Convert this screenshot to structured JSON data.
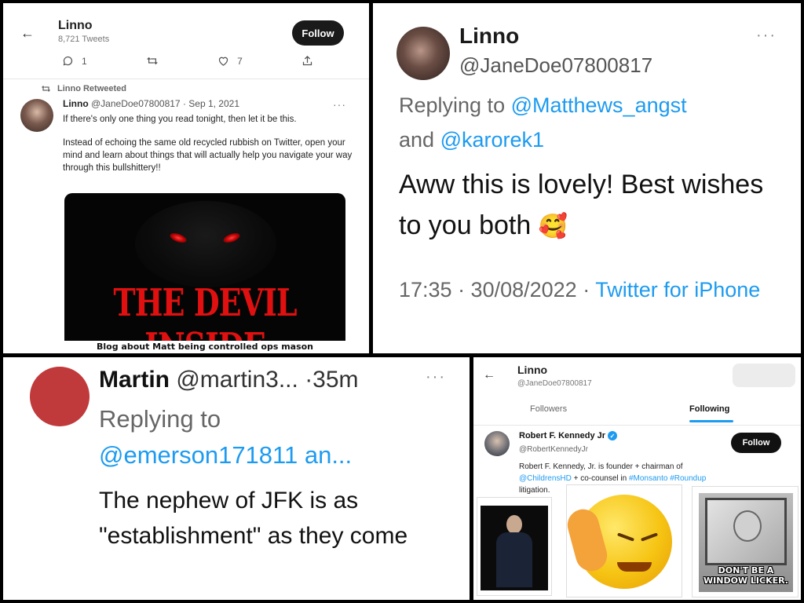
{
  "panel1": {
    "profile_name": "Linno",
    "tweet_count": "8,721 Tweets",
    "follow_label": "Follow",
    "actions": {
      "replies": "1",
      "likes": "7"
    },
    "retweeted_label": "Linno Retweeted",
    "tweet": {
      "author": "Linno",
      "handle": "@JaneDoe07800817",
      "date": "· Sep 1, 2021",
      "line1": "If there's only one thing you read tonight, then let it be this.",
      "line2": "Instead of echoing the same old recycled rubbish on Twitter, open your mind and learn about things that will actually help you navigate your way through this bullshittery!!"
    },
    "image_title": "THE DEVIL INSIDE",
    "caption": "Blog about Matt being controlled ops mason"
  },
  "panel2": {
    "name": "Linno",
    "handle": "@JaneDoe07800817",
    "replying_prefix": "Replying to",
    "mention1": "@Matthews_angst",
    "and": "and",
    "mention2": "@karorek1",
    "body": "Aww this is lovely! Best wishes to you both",
    "emoji": "🥰",
    "timestamp": "17:35 · 30/08/2022 ·",
    "source": "Twitter for iPhone"
  },
  "panel3": {
    "name": "Martin",
    "handle": "@martin3...",
    "time": "·35m",
    "replying_prefix": "Replying to",
    "mention": "@emerson171811 an...",
    "body": "The nephew of JFK is as \"establishment\" as they come"
  },
  "panel4": {
    "profile_name": "Linno",
    "profile_handle": "@JaneDoe07800817",
    "tabs": [
      "Followers",
      "Following"
    ],
    "account": {
      "name": "Robert F. Kennedy Jr",
      "handle": "@RobertKennedyJr",
      "follow_label": "Follow",
      "bio_pre": "Robert F. Kennedy, Jr. is founder + chairman of",
      "bio_link1": "@ChildrensHD",
      "bio_mid": "+ co-counsel in",
      "bio_link2": "#Monsanto #Roundup",
      "bio_post": "litigation."
    },
    "meme_text_line1": "DON'T BE A",
    "meme_text_line2": "WINDOW LICKER."
  },
  "colors": {
    "link_blue": "#1d9bf0",
    "devil_red": "#e01010"
  },
  "icons": [
    "back-arrow-icon",
    "reply-icon",
    "retweet-icon",
    "like-icon",
    "share-icon",
    "more-icon",
    "verified-icon"
  ]
}
